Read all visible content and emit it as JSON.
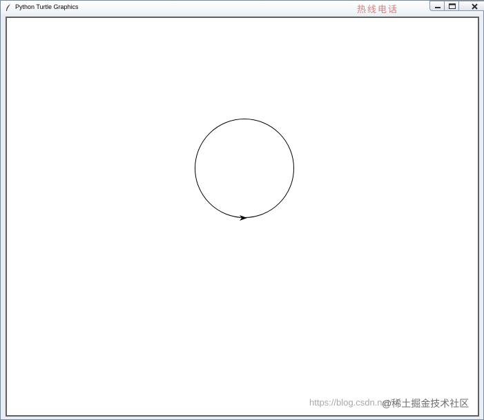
{
  "window": {
    "title": "Python Turtle Graphics",
    "background_title_text": "热线电话",
    "icons": {
      "app": "feather-icon",
      "minimize": "minimize-icon",
      "maximize": "maximize-icon",
      "close": "close-icon"
    }
  },
  "canvas": {
    "background_color": "#ffffff",
    "drawing": {
      "shape": "circle",
      "stroke_color": "#000000",
      "turtle_heading": "east",
      "turtle_cursor": "arrow-cursor-icon"
    }
  },
  "watermark": {
    "url_text": "https://blog.csdn.net/",
    "overlay_text": "@稀土掘金技术社区"
  }
}
